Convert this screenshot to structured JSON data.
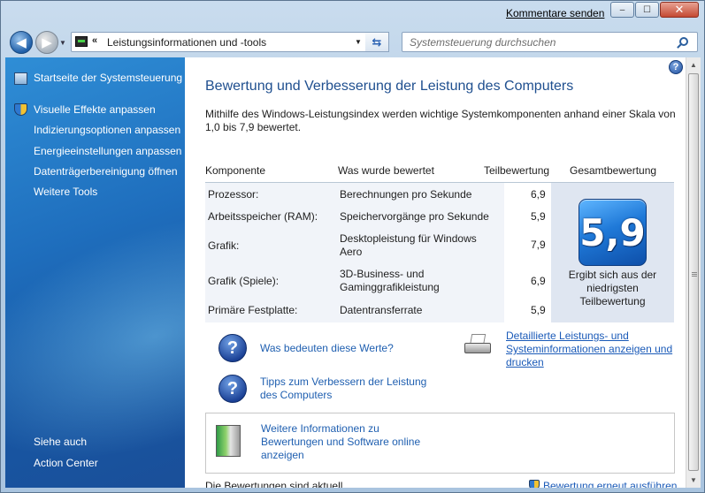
{
  "titlebar": {
    "feedback_link": "Kommentare senden",
    "min": "–",
    "max": "☐",
    "close": "✕"
  },
  "navigation": {
    "back": "◀",
    "forward": "▶",
    "breadcrumb_chevron": "«",
    "address": "Leistungsinformationen und -tools",
    "refresh": "⇆",
    "search_placeholder": "Systemsteuerung durchsuchen"
  },
  "sidebar": {
    "home": "Startseite der Systemsteuerung",
    "tasks": [
      "Visuelle Effekte anpassen",
      "Indizierungsoptionen anpassen",
      "Energieeinstellungen anpassen",
      "Datenträgerbereinigung öffnen",
      "Weitere Tools"
    ],
    "see_also_heading": "Siehe auch",
    "see_also": [
      "Action Center"
    ]
  },
  "main": {
    "help": "?",
    "title": "Bewertung und Verbesserung der Leistung des Computers",
    "intro": "Mithilfe des Windows-Leistungsindex werden wichtige Systemkomponenten anhand einer Skala von 1,0 bis 7,9 bewertet.",
    "table": {
      "headers": [
        "Komponente",
        "Was wurde bewertet",
        "Teilbewertung",
        "Gesamtbewertung"
      ],
      "rows": [
        {
          "component": "Prozessor:",
          "rated": "Berechnungen pro Sekunde",
          "score": "6,9"
        },
        {
          "component": "Arbeitsspeicher (RAM):",
          "rated": "Speichervorgänge pro Sekunde",
          "score": "5,9"
        },
        {
          "component": "Grafik:",
          "rated": "Desktopleistung für Windows Aero",
          "score": "7,9"
        },
        {
          "component": "Grafik (Spiele):",
          "rated": "3D-Business- und Gaminggrafikleistung",
          "score": "6,9"
        },
        {
          "component": "Primäre Festplatte:",
          "rated": "Datentransferrate",
          "score": "5,9"
        }
      ],
      "base_score": "5,9",
      "base_caption": "Ergibt sich aus der niedrigsten Teilbewertung"
    },
    "links": {
      "what_mean": "Was bedeuten diese Werte?",
      "tips": "Tipps zum Verbessern der Leistung des Computers",
      "details": "Detaillierte Leistungs- und Systeminformationen anzeigen und drucken",
      "more_info": "Weitere Informationen zu Bewertungen und Software online anzeigen"
    },
    "question_icon": "?",
    "status": "Die Bewertungen sind aktuell",
    "rerun": "Bewertung erneut ausführen"
  },
  "scrollbar": {
    "up": "▲",
    "down": "▼"
  }
}
